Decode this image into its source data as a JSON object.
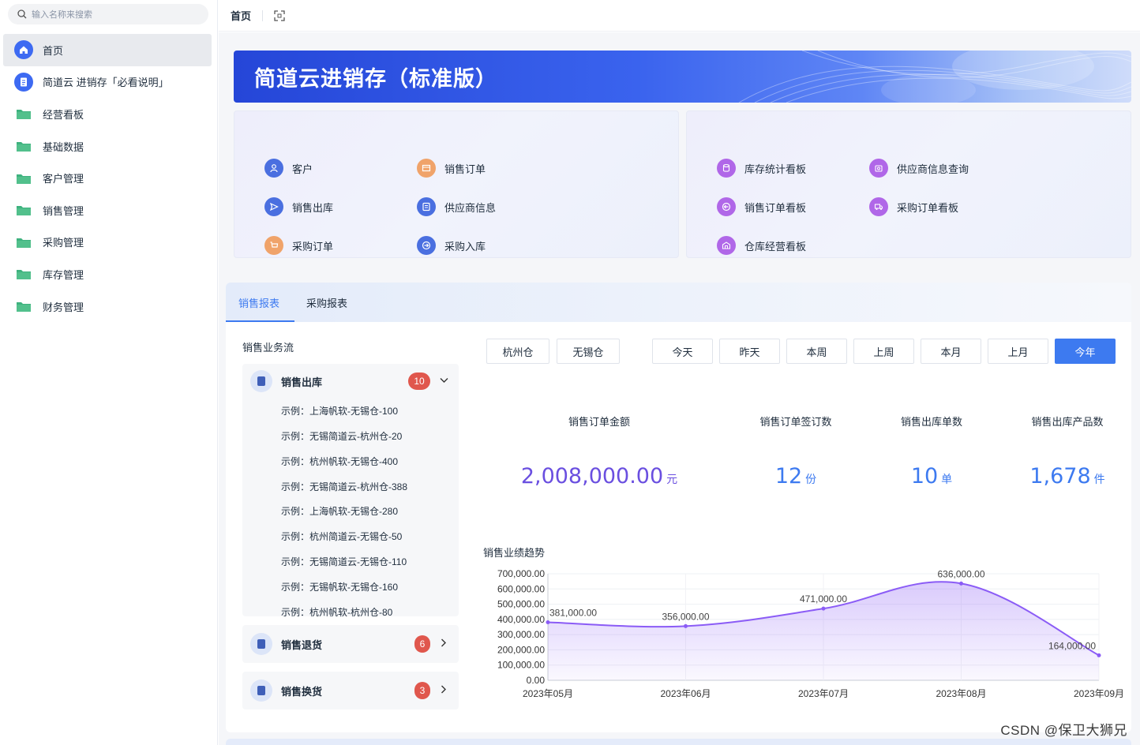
{
  "search": {
    "placeholder": "输入名称来搜索"
  },
  "sidebar": {
    "items": [
      {
        "label": "首页",
        "icon": "home-icon",
        "active": true
      },
      {
        "label": "简道云 进销存「必看说明」",
        "icon": "doc-icon"
      },
      {
        "label": "经营看板",
        "icon": "folder-icon"
      },
      {
        "label": "基础数据",
        "icon": "folder-icon"
      },
      {
        "label": "客户管理",
        "icon": "folder-icon"
      },
      {
        "label": "销售管理",
        "icon": "folder-icon"
      },
      {
        "label": "采购管理",
        "icon": "folder-icon"
      },
      {
        "label": "库存管理",
        "icon": "folder-icon"
      },
      {
        "label": "财务管理",
        "icon": "folder-icon"
      }
    ]
  },
  "topbar": {
    "title": "首页",
    "fullscreen_icon": "fullscreen-icon"
  },
  "banner": {
    "title": "简道云进销存（标准版）"
  },
  "quick_left": [
    {
      "label": "客户",
      "color": "#4a6fe0"
    },
    {
      "label": "销售订单",
      "color": "#f0a36a"
    },
    {
      "label": "销售出库",
      "color": "#4a6fe0"
    },
    {
      "label": "供应商信息",
      "color": "#4a6fe0"
    },
    {
      "label": "采购订单",
      "color": "#f0a36a"
    },
    {
      "label": "采购入库",
      "color": "#4a6fe0"
    }
  ],
  "quick_right": [
    {
      "label": "库存统计看板",
      "color": "#b067e8"
    },
    {
      "label": "供应商信息查询",
      "color": "#b067e8"
    },
    {
      "label": "销售订单看板",
      "color": "#b067e8"
    },
    {
      "label": "采购订单看板",
      "color": "#b067e8"
    },
    {
      "label": "仓库经营看板",
      "color": "#b067e8"
    }
  ],
  "report": {
    "tabs": [
      "销售报表",
      "采购报表"
    ],
    "flow_title": "销售业务流",
    "flow": {
      "main": {
        "label": "销售出库",
        "count": "10"
      },
      "subs": [
        "示例：上海帆软-无锡仓-100",
        "示例：无锡简道云-杭州仓-20",
        "示例：杭州帆软-无锡仓-400",
        "示例：无锡简道云-杭州仓-388",
        "示例：上海帆软-无锡仓-280",
        "示例：杭州简道云-无锡仓-50",
        "示例：无锡简道云-无锡仓-110",
        "示例：无锡帆软-无锡仓-160",
        "示例：杭州帆软-杭州仓-80"
      ],
      "returns": {
        "label": "销售退货",
        "count": "6"
      },
      "exchange": {
        "label": "销售换货",
        "count": "3"
      }
    },
    "warehouses": [
      "杭州仓",
      "无锡仓"
    ],
    "periods": [
      "今天",
      "昨天",
      "本周",
      "上周",
      "本月",
      "上月",
      "今年"
    ],
    "selected_period": "今年",
    "metrics": [
      {
        "label": "销售订单金额",
        "value": "2,008,000.00",
        "unit": "元",
        "color": "#6a4fe0"
      },
      {
        "label": "销售订单签订数",
        "value": "12",
        "unit": "份",
        "color": "#3d7af0"
      },
      {
        "label": "销售出库单数",
        "value": "10",
        "unit": "单",
        "color": "#3d7af0"
      },
      {
        "label": "销售出库产品数",
        "value": "1,678",
        "unit": "件",
        "color": "#3d7af0"
      }
    ],
    "chart_title": "销售业绩趋势"
  },
  "chart_data": {
    "type": "area",
    "title": "销售业绩趋势",
    "x": [
      "2023年05月",
      "2023年06月",
      "2023年07月",
      "2023年08月",
      "2023年09月"
    ],
    "series": [
      {
        "values": [
          381000,
          356000,
          471000,
          636000,
          164000
        ]
      }
    ],
    "data_labels": [
      "381,000.00",
      "356,000.00",
      "471,000.00",
      "636,000.00",
      "164,000.00"
    ],
    "y_ticks": [
      "700,000.00",
      "600,000.00",
      "500,000.00",
      "400,000.00",
      "300,000.00",
      "200,000.00",
      "100,000.00",
      "0.00"
    ],
    "ylim": [
      0,
      700000
    ],
    "line_color": "#8b5cf6",
    "grid": true
  },
  "watermark": "CSDN @保卫大狮兄"
}
